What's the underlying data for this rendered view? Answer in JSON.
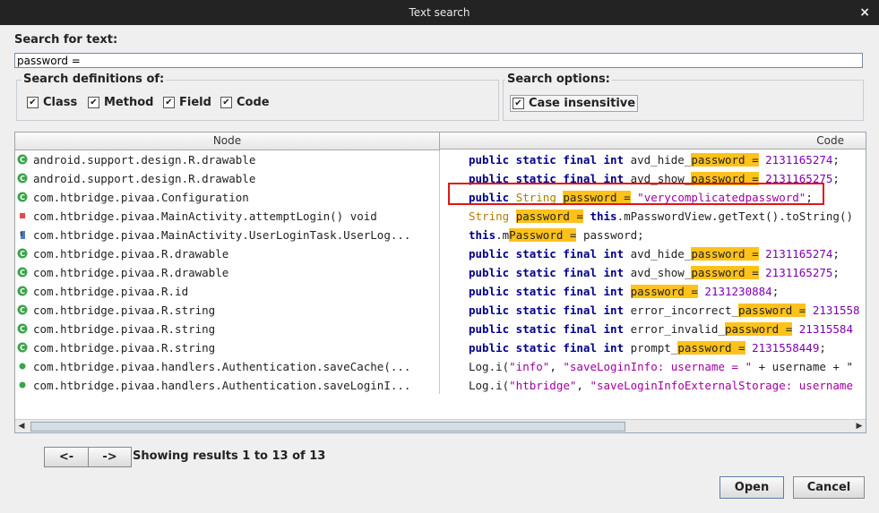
{
  "window": {
    "title": "Text search",
    "close_glyph": "×"
  },
  "search": {
    "label": "Search for text:",
    "value": "password ="
  },
  "definitions": {
    "label": "Search definitions of:",
    "options": [
      {
        "label": "Class",
        "checked": true
      },
      {
        "label": "Method",
        "checked": true
      },
      {
        "label": "Field",
        "checked": true
      },
      {
        "label": "Code",
        "checked": true
      }
    ]
  },
  "search_options": {
    "label": "Search options:",
    "case_insensitive": {
      "label": "Case insensitive",
      "checked": true
    }
  },
  "table": {
    "col_node": "Node",
    "col_code": "Code",
    "rows": [
      {
        "icon": "class-icon",
        "node": "android.support.design.R.drawable"
      },
      {
        "icon": "class-icon",
        "node": "android.support.design.R.drawable"
      },
      {
        "icon": "class-icon",
        "node": "com.htbridge.pivaa.Configuration"
      },
      {
        "icon": "private-method-icon",
        "node": "com.htbridge.pivaa.MainActivity.attemptLogin() void"
      },
      {
        "icon": "inner-class-icon",
        "node": "com.htbridge.pivaa.MainActivity.UserLoginTask.UserLog..."
      },
      {
        "icon": "class-icon",
        "node": "com.htbridge.pivaa.R.drawable"
      },
      {
        "icon": "class-icon",
        "node": "com.htbridge.pivaa.R.drawable"
      },
      {
        "icon": "class-icon",
        "node": "com.htbridge.pivaa.R.id"
      },
      {
        "icon": "class-icon",
        "node": "com.htbridge.pivaa.R.string"
      },
      {
        "icon": "class-icon",
        "node": "com.htbridge.pivaa.R.string"
      },
      {
        "icon": "class-icon",
        "node": "com.htbridge.pivaa.R.string"
      },
      {
        "icon": "public-method-icon",
        "node": "com.htbridge.pivaa.handlers.Authentication.saveCache(..."
      },
      {
        "icon": "public-method-icon",
        "node": "com.htbridge.pivaa.handlers.Authentication.saveLoginI..."
      }
    ],
    "code_lines": [
      [
        [
          "kw",
          "public static final "
        ],
        [
          "kw",
          "int"
        ],
        [
          "",
          "avd_hide_"
        ],
        [
          "hl",
          "password ="
        ],
        [
          "num",
          " 2131165274"
        ],
        [
          "",
          ";"
        ]
      ],
      [
        [
          "kw",
          "public static final "
        ],
        [
          "kw",
          "int"
        ],
        [
          "",
          "avd_show_"
        ],
        [
          "hl",
          "password ="
        ],
        [
          "num",
          " 2131165275"
        ],
        [
          "",
          ";"
        ]
      ],
      [
        [
          "kw",
          "public "
        ],
        [
          "ty",
          "String "
        ],
        [
          "hl",
          "password ="
        ],
        [
          "str",
          " \"verycomplicatedpassword\""
        ],
        [
          "",
          ";"
        ]
      ],
      [
        [
          "ty",
          "String "
        ],
        [
          "hl",
          "password ="
        ],
        [
          "kw",
          " this"
        ],
        [
          "",
          ".mPasswordView.getText().toString()"
        ]
      ],
      [
        [
          "kw",
          "this"
        ],
        [
          "",
          ".m"
        ],
        [
          "hl",
          "Password ="
        ],
        [
          "",
          " password;"
        ]
      ],
      [
        [
          "kw",
          "public static final "
        ],
        [
          "kw",
          "int"
        ],
        [
          "",
          "avd_hide_"
        ],
        [
          "hl",
          "password ="
        ],
        [
          "num",
          " 2131165274"
        ],
        [
          "",
          ";"
        ]
      ],
      [
        [
          "kw",
          "public static final "
        ],
        [
          "kw",
          "int"
        ],
        [
          "",
          "avd_show_"
        ],
        [
          "hl",
          "password ="
        ],
        [
          "num",
          " 2131165275"
        ],
        [
          "",
          ";"
        ]
      ],
      [
        [
          "kw",
          "public static final "
        ],
        [
          "kw",
          "int"
        ],
        [
          "hl",
          " password ="
        ],
        [
          "num",
          " 2131230884"
        ],
        [
          "",
          ";"
        ]
      ],
      [
        [
          "kw",
          "public static final "
        ],
        [
          "kw",
          "int"
        ],
        [
          "",
          "error_incorrect_"
        ],
        [
          "hl",
          "password ="
        ],
        [
          "num",
          " 2131558"
        ]
      ],
      [
        [
          "kw",
          "public static final "
        ],
        [
          "kw",
          "int"
        ],
        [
          "",
          "error_invalid_"
        ],
        [
          "hl",
          "password ="
        ],
        [
          "num",
          " 21315584"
        ]
      ],
      [
        [
          "kw",
          "public static final "
        ],
        [
          "kw",
          "int"
        ],
        [
          "",
          "prompt_"
        ],
        [
          "hl",
          "password ="
        ],
        [
          "num",
          " 2131558449"
        ],
        [
          "",
          ";"
        ]
      ],
      [
        [
          "",
          "Log.i("
        ],
        [
          "str",
          "\"info\""
        ],
        [
          "",
          ", "
        ],
        [
          "str",
          "\"saveLoginInfo: username = \""
        ],
        [
          "",
          " + username + \""
        ]
      ],
      [
        [
          "",
          "Log.i("
        ],
        [
          "str",
          "\"htbridge\""
        ],
        [
          "",
          ", "
        ],
        [
          "str",
          "\"saveLoginInfoExternalStorage: username"
        ]
      ]
    ]
  },
  "pager": {
    "prev": "<-",
    "next": "->",
    "status": "Showing results 1 to 13 of 13"
  },
  "buttons": {
    "open": "Open",
    "cancel": "Cancel"
  },
  "colors": {
    "keyword": "#00008b",
    "type": "#b07d00",
    "string": "#a000a0",
    "highlight": "#ffc21a",
    "selection_box": "#e01515"
  }
}
